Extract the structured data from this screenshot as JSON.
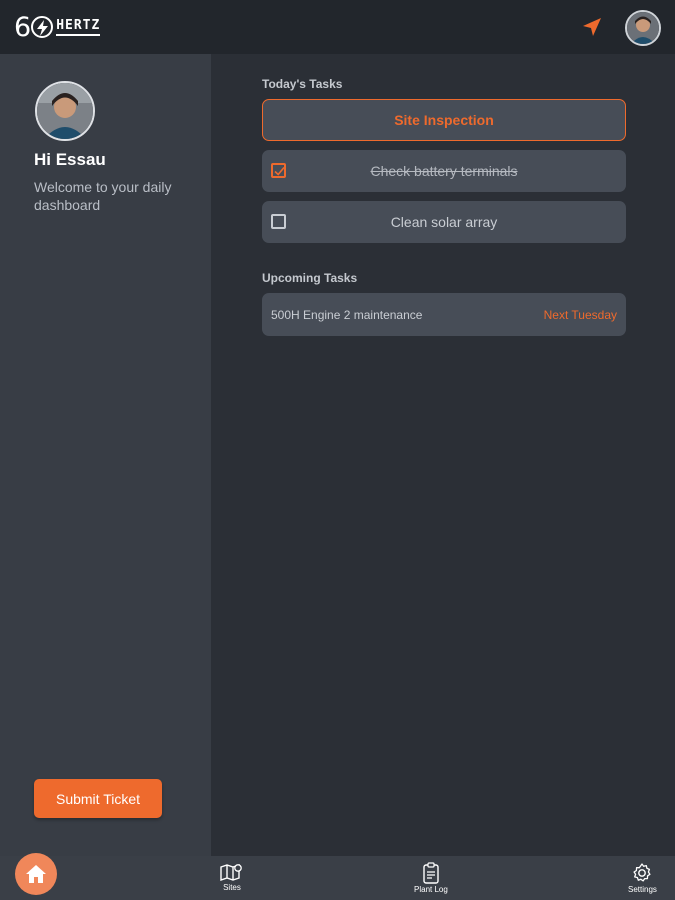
{
  "app": {
    "logo_digits": "60",
    "logo_word": "HERTZ"
  },
  "colors": {
    "accent": "#ee6a2d",
    "background": "#2b2f36",
    "sidebar": "#383d45",
    "card": "#474d57",
    "topbar": "#22262c"
  },
  "topbar": {
    "nav_icon": "navigation-arrow-icon",
    "avatar_icon": "user-avatar"
  },
  "sidebar": {
    "greeting": "Hi Essau",
    "welcome": "Welcome to your daily dashboard",
    "submit_label": "Submit Ticket"
  },
  "today": {
    "title": "Today's Tasks",
    "tasks": [
      {
        "label": "Site Inspection",
        "type": "primary"
      },
      {
        "label": "Check battery terminals",
        "checked": true
      },
      {
        "label": "Clean solar array",
        "checked": false
      }
    ]
  },
  "upcoming": {
    "title": "Upcoming Tasks",
    "items": [
      {
        "name": "500H Engine 2 maintenance",
        "when": "Next Tuesday"
      }
    ]
  },
  "bottomnav": {
    "items": [
      {
        "label": "",
        "icon": "home-icon"
      },
      {
        "label": "Sites",
        "icon": "map-icon"
      },
      {
        "label": "Plant Log",
        "icon": "clipboard-icon"
      },
      {
        "label": "Settings",
        "icon": "gear-icon"
      }
    ]
  }
}
